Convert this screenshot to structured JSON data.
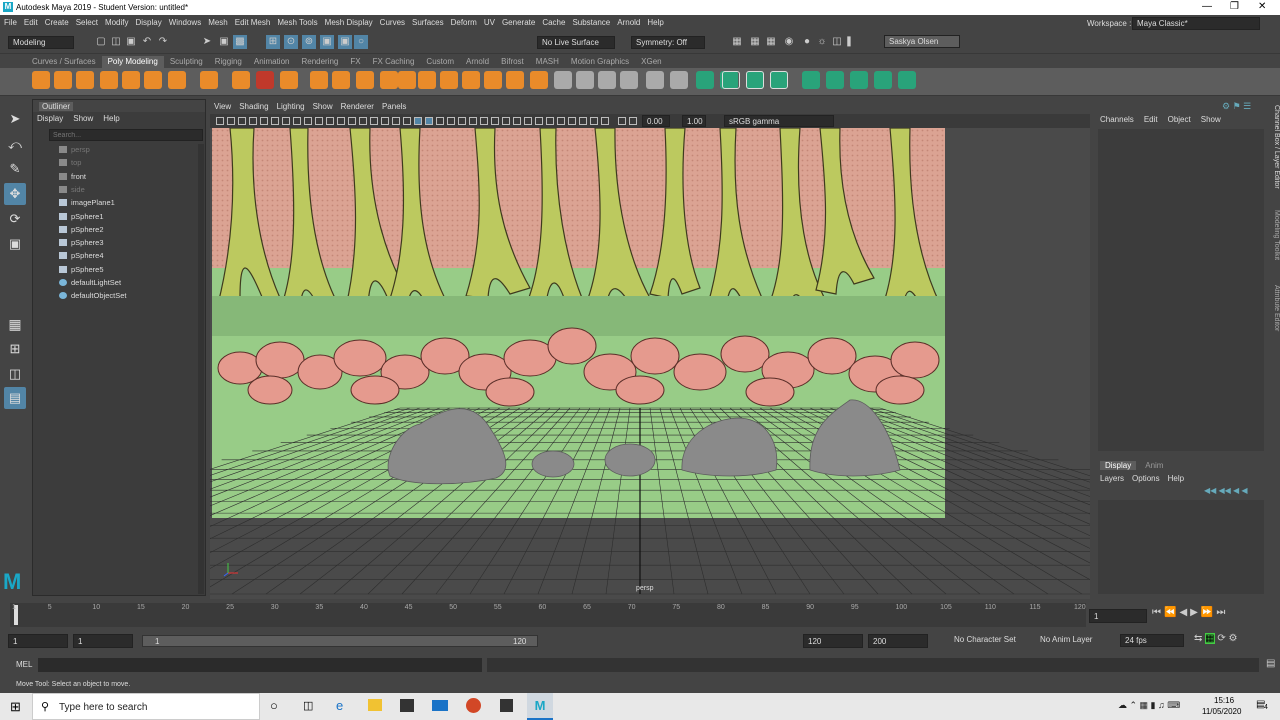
{
  "window": {
    "title": "Autodesk Maya 2019 - Student Version: untitled*"
  },
  "menubar": [
    "File",
    "Edit",
    "Create",
    "Select",
    "Modify",
    "Display",
    "Windows",
    "Mesh",
    "Edit Mesh",
    "Mesh Tools",
    "Mesh Display",
    "Curves",
    "Surfaces",
    "Deform",
    "UV",
    "Generate",
    "Cache",
    "Substance",
    "Arnold",
    "Help"
  ],
  "workspace": {
    "label": "Workspace :",
    "value": "Maya Classic*"
  },
  "statusline": {
    "mode": "Modeling",
    "live_surface": "No Live Surface",
    "symmetry": "Symmetry: Off",
    "user": "Saskya Olsen"
  },
  "shelf_tabs": [
    "Curves / Surfaces",
    "Poly Modeling",
    "Sculpting",
    "Rigging",
    "Animation",
    "Rendering",
    "FX",
    "FX Caching",
    "Custom",
    "Arnold",
    "Bifrost",
    "MASH",
    "Motion Graphics",
    "XGen"
  ],
  "shelf_active": "Poly Modeling",
  "outliner": {
    "title": "Outliner",
    "menu": [
      "Display",
      "Show",
      "Help"
    ],
    "search_placeholder": "Search...",
    "items": [
      {
        "label": "persp",
        "dim": true,
        "icon": "camera-icon"
      },
      {
        "label": "top",
        "dim": true,
        "icon": "camera-icon"
      },
      {
        "label": "front",
        "dim": false,
        "icon": "camera-icon"
      },
      {
        "label": "side",
        "dim": true,
        "icon": "camera-icon"
      },
      {
        "label": "imagePlane1",
        "dim": false,
        "icon": "image-plane-icon"
      },
      {
        "label": "pSphere1",
        "dim": false,
        "icon": "mesh-icon"
      },
      {
        "label": "pSphere2",
        "dim": false,
        "icon": "mesh-icon"
      },
      {
        "label": "pSphere3",
        "dim": false,
        "icon": "mesh-icon"
      },
      {
        "label": "pSphere4",
        "dim": false,
        "icon": "mesh-icon"
      },
      {
        "label": "pSphere5",
        "dim": false,
        "icon": "mesh-icon"
      },
      {
        "label": "defaultLightSet",
        "dim": false,
        "icon": "set-icon"
      },
      {
        "label": "defaultObjectSet",
        "dim": false,
        "icon": "set-icon"
      }
    ]
  },
  "viewport": {
    "menu": [
      "View",
      "Shading",
      "Lighting",
      "Show",
      "Renderer",
      "Panels"
    ],
    "exposure": "0.00",
    "gamma": "1.00",
    "colorspace": "sRGB gamma",
    "camera_label": "persp"
  },
  "channelbox": {
    "menu": [
      "Channels",
      "Edit",
      "Object",
      "Show"
    ]
  },
  "layer_editor": {
    "tabs": [
      "Display",
      "Anim"
    ],
    "menu": [
      "Layers",
      "Options",
      "Help"
    ]
  },
  "side_tabs": [
    "Channel Box / Layer Editor",
    "Modeling Toolkit",
    "Attribute Editor"
  ],
  "timeline": {
    "ticks": [
      "1",
      "5",
      "10",
      "15",
      "20",
      "25",
      "30",
      "35",
      "40",
      "45",
      "50",
      "55",
      "60",
      "65",
      "70",
      "75",
      "80",
      "85",
      "90",
      "95",
      "100",
      "105",
      "110",
      "115",
      "120"
    ],
    "current_frame": "1"
  },
  "range": {
    "start": "1",
    "playback_start": "1",
    "slider_start": "1",
    "slider_end": "120",
    "playback_end": "120",
    "end": "200",
    "character_set": "No Character Set",
    "anim_layer": "No Anim Layer",
    "fps": "24 fps"
  },
  "cmdline": {
    "label": "MEL"
  },
  "helpline": {
    "text": "Move Tool: Select an object to move."
  },
  "taskbar": {
    "search_placeholder": "Type here to search",
    "time": "15:16",
    "date": "11/05/2020",
    "notifications": "4"
  }
}
